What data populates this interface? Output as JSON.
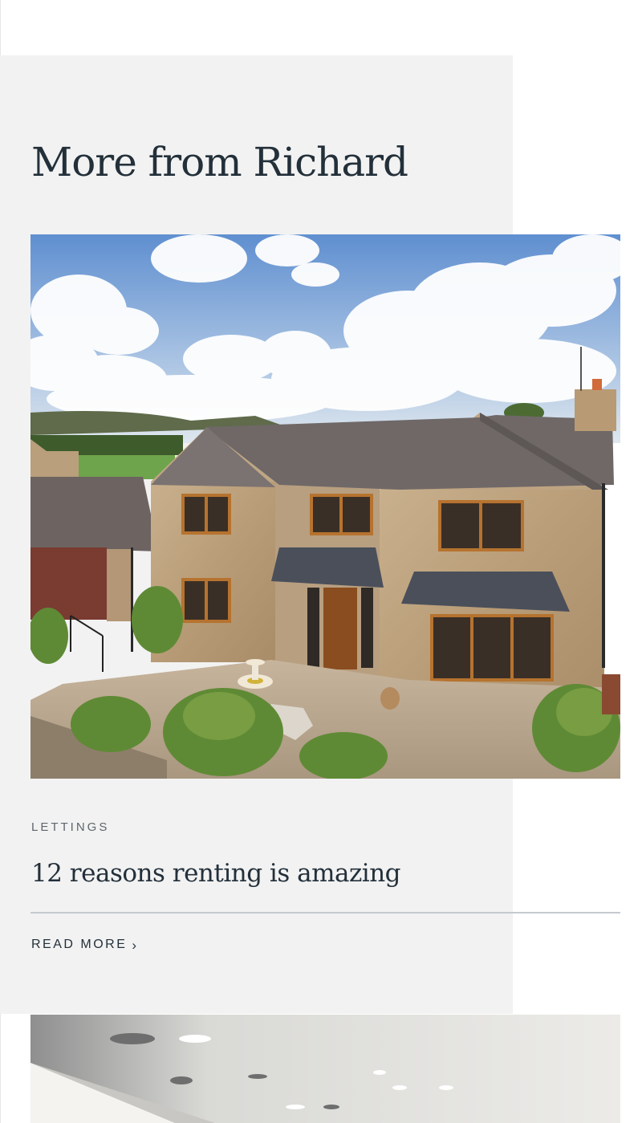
{
  "section": {
    "title": "More from Richard"
  },
  "cards": [
    {
      "image_alt": "Stone detached house with slate roof, patio and garden",
      "category": "LETTINGS",
      "title": "12 reasons renting is amazing",
      "read_more": "READ MORE",
      "read_more_icon": "chevron-right-icon"
    },
    {
      "image_alt": "Interior ceiling with recessed spotlights"
    }
  ],
  "colors": {
    "panel_bg": "#f2f2f2",
    "text_dark": "#23303a",
    "text_muted": "#5e666d",
    "divider": "#c4cacf"
  }
}
